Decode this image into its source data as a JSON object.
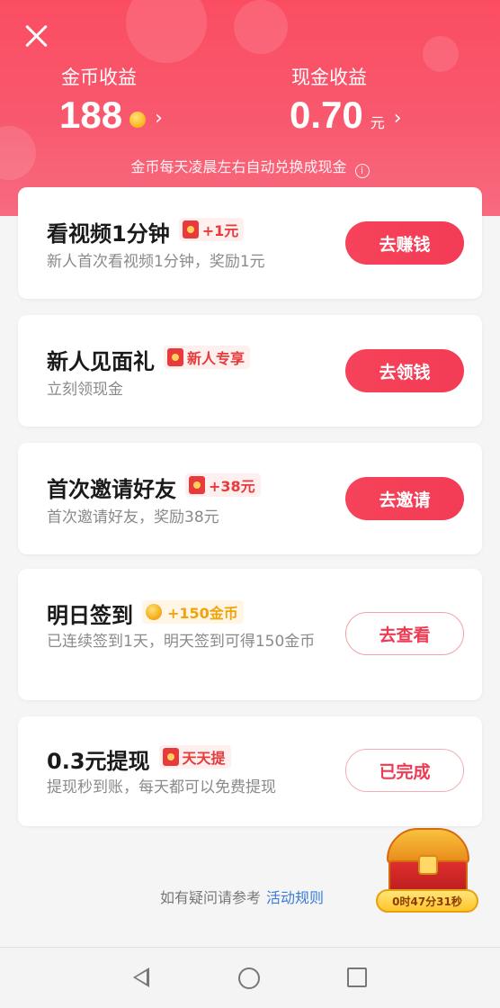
{
  "header": {
    "coin_label": "金币收益",
    "coin_value": "188",
    "cash_label": "现金收益",
    "cash_value": "0.70",
    "cash_unit": "元",
    "chevron": "›",
    "notice": "金币每天凌晨左右自动兑换成现金",
    "info_glyph": "i"
  },
  "tasks": [
    {
      "title": "看视频1分钟",
      "tag": "+1元",
      "tag_icon": "red-packet-icon",
      "desc": "新人首次看视频1分钟，奖励1元",
      "button": "去赚钱",
      "button_style": "solid"
    },
    {
      "title": "新人见面礼",
      "tag": "新人专享",
      "tag_icon": "red-packet-icon",
      "desc": "立刻领现金",
      "button": "去领钱",
      "button_style": "solid"
    },
    {
      "title": "首次邀请好友",
      "tag": "+38元",
      "tag_icon": "red-packet-icon",
      "desc": "首次邀请好友，奖励38元",
      "button": "去邀请",
      "button_style": "solid"
    },
    {
      "title": "明日签到",
      "tag": "+150金币",
      "tag_icon": "coin-icon",
      "desc": "已连续签到1天，明天签到可得150金币",
      "button": "去查看",
      "button_style": "outline"
    },
    {
      "title": "0.3元提现",
      "tag": "天天提",
      "tag_icon": "red-packet-icon",
      "desc": "提现秒到账，每天都可以免费提现",
      "button": "已完成",
      "button_style": "done"
    }
  ],
  "footer": {
    "help_text": "如有疑问请参考",
    "rules_link": "活动规则"
  },
  "treasure": {
    "timer": "0时47分31秒"
  },
  "colors": {
    "header_red": "#fb4d62",
    "button_red": "#f33b55",
    "link_blue": "#3a7bd8",
    "coin_gold": "#f8b51b"
  }
}
